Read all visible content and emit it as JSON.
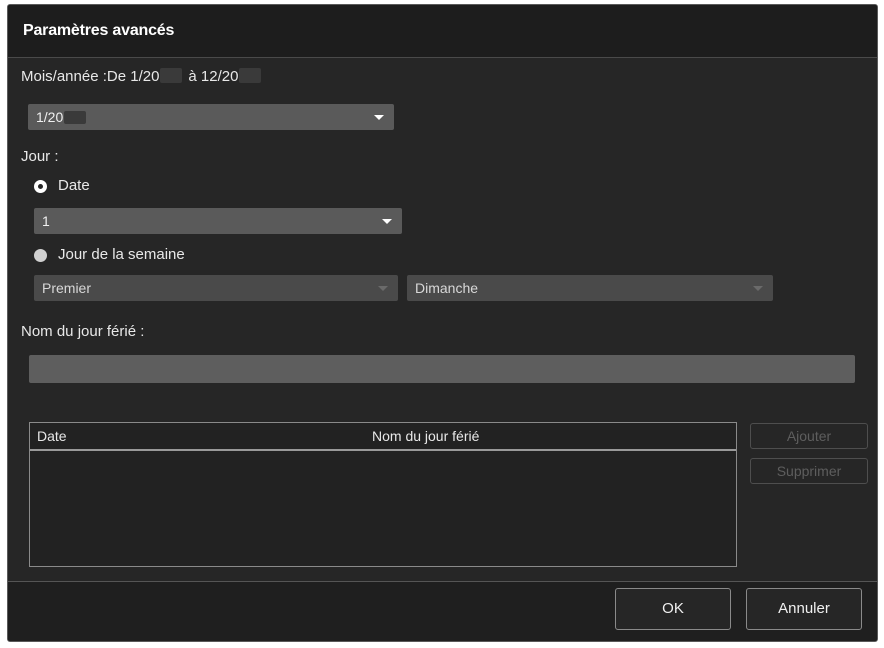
{
  "dialog": {
    "title": "Paramètres avancés",
    "month_year_prefix": "Mois/année :De 1/20",
    "month_year_mid": "à 12/20",
    "month_select_value": "1/20",
    "day_label": "Jour :",
    "radio_date_label": "Date",
    "date_select_value": "1",
    "radio_weekday_label": "Jour de la semaine",
    "week_ordinal_value": "Premier",
    "weekday_value": "Dimanche",
    "holiday_name_label": "Nom du jour férié :",
    "holiday_name_value": ""
  },
  "table": {
    "columns": [
      "Date",
      "Nom du jour férié"
    ],
    "rows": []
  },
  "buttons": {
    "add": "Ajouter",
    "delete": "Supprimer",
    "ok": "OK",
    "cancel": "Annuler"
  },
  "state": {
    "selected_day_mode": "Date",
    "add_enabled": false,
    "delete_enabled": false
  },
  "colors": {
    "dialog_bg": "#262626",
    "title_bg": "#1d1d1d",
    "combo_bg": "#5a5a5a"
  }
}
